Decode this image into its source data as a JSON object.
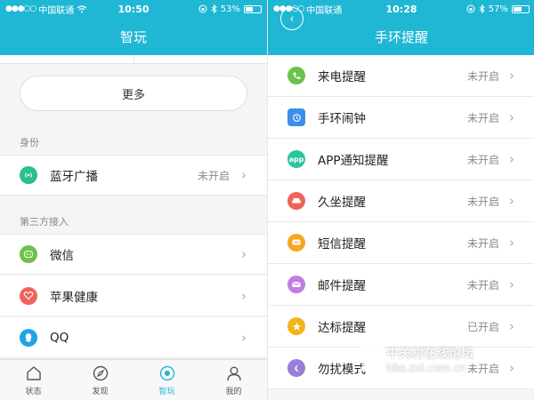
{
  "left": {
    "status": {
      "carrier": "中国联通",
      "time": "10:50",
      "battery": "53%",
      "battery_level": 0.53
    },
    "title": "智玩",
    "more_button": "更多",
    "sections": [
      {
        "label": "身份"
      },
      {
        "label": "第三方接入"
      }
    ],
    "rows": [
      {
        "label": "蓝牙广播",
        "status": "未开启",
        "icon": "bluetooth-broadcast-icon",
        "color": "#2bbf8a"
      },
      {
        "label": "微信",
        "status": "",
        "icon": "wechat-icon",
        "color": "#6cc24a"
      },
      {
        "label": "苹果健康",
        "status": "",
        "icon": "heart-icon",
        "color": "#f0625a"
      },
      {
        "label": "QQ",
        "status": "",
        "icon": "qq-icon",
        "color": "#1fa3e8"
      }
    ],
    "tabs": [
      {
        "label": "状态",
        "icon": "home-icon"
      },
      {
        "label": "发现",
        "icon": "compass-icon"
      },
      {
        "label": "智玩",
        "icon": "target-icon"
      },
      {
        "label": "我的",
        "icon": "user-icon"
      }
    ]
  },
  "right": {
    "status": {
      "carrier": "中国联通",
      "time": "10:28",
      "battery": "57%",
      "battery_level": 0.57
    },
    "title": "手环提醒",
    "rows": [
      {
        "label": "来电提醒",
        "status": "未开启",
        "icon": "phone-icon",
        "color": "#6cc24a"
      },
      {
        "label": "手环闹钟",
        "status": "未开启",
        "icon": "alarm-icon",
        "color": "#3b8fe8"
      },
      {
        "label": "APP通知提醒",
        "status": "未开启",
        "icon": "app-icon",
        "icon_text": "app",
        "color": "#2bc4a0"
      },
      {
        "label": "久坐提醒",
        "status": "未开启",
        "icon": "sofa-icon",
        "color": "#f0625a"
      },
      {
        "label": "短信提醒",
        "status": "未开启",
        "icon": "message-icon",
        "color": "#f5a623"
      },
      {
        "label": "邮件提醒",
        "status": "未开启",
        "icon": "mail-icon",
        "color": "#c07de0"
      },
      {
        "label": "达标提醒",
        "status": "已开启",
        "icon": "star-icon",
        "color": "#f5b31b"
      },
      {
        "label": "勿扰模式",
        "status": "未开启",
        "icon": "moon-icon",
        "color": "#9b7ed8"
      }
    ]
  },
  "watermark": {
    "title": "中关村在线论坛",
    "url": "bbs.zol.com.cn"
  },
  "colors": {
    "accent": "#1fb7d4"
  }
}
